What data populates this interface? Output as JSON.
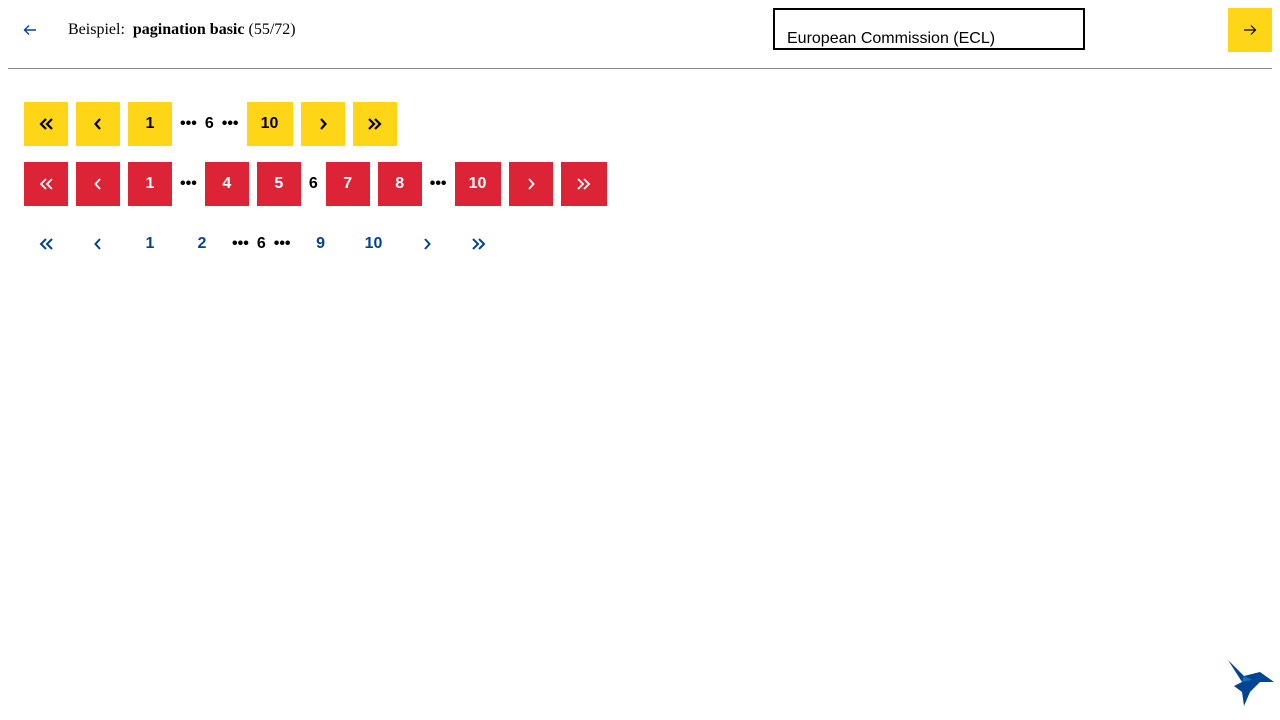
{
  "header": {
    "back_icon": "arrow-left-icon",
    "title_prefix": "Beispiel:",
    "title_name": "pagination basic",
    "title_count": "(55/72)",
    "select_value": "European Commission (ECL)",
    "next_icon": "arrow-right-icon",
    "accent_color": "#ffd617"
  },
  "pagers": [
    {
      "variant": "yellow",
      "color": "#ffd617",
      "first_icon": "double-chevron-left-icon",
      "prev_icon": "chevron-left-icon",
      "next_icon": "chevron-right-icon",
      "last_icon": "double-chevron-right-icon",
      "pages": [
        "1",
        "10"
      ],
      "current": "6",
      "ellipsis": "•••"
    },
    {
      "variant": "red",
      "color": "#dc2436",
      "first_icon": "double-chevron-left-icon",
      "prev_icon": "chevron-left-icon",
      "next_icon": "chevron-right-icon",
      "last_icon": "double-chevron-right-icon",
      "pages": [
        "1",
        "4",
        "5",
        "7",
        "8",
        "10"
      ],
      "current": "6",
      "ellipsis": "•••"
    },
    {
      "variant": "plain",
      "color": "#004494",
      "first_icon": "double-chevron-left-icon",
      "prev_icon": "chevron-left-icon",
      "next_icon": "chevron-right-icon",
      "last_icon": "double-chevron-right-icon",
      "pages": [
        "1",
        "2",
        "9",
        "10"
      ],
      "current": "6",
      "ellipsis": "•••"
    }
  ],
  "logo_icon": "hummingbird-logo-icon"
}
